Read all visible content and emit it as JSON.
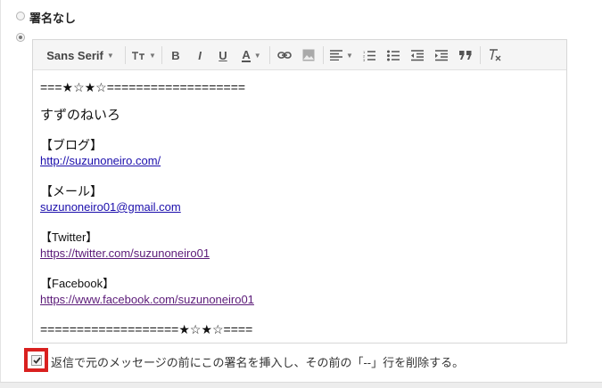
{
  "signature_options": {
    "no_signature_label": "署名なし",
    "no_signature_selected": false,
    "custom_signature_selected": true
  },
  "toolbar": {
    "font_family": "Sans Serif",
    "icons": [
      "font-size-icon",
      "bold-icon",
      "italic-icon",
      "underline-icon",
      "text-color-icon",
      "link-icon",
      "image-icon",
      "align-icon",
      "numbered-list-icon",
      "bulleted-list-icon",
      "indent-less-icon",
      "indent-more-icon",
      "quote-icon",
      "remove-formatting-icon"
    ],
    "bold": "B",
    "italic": "I",
    "underline": "U",
    "text_color": "A"
  },
  "signature": {
    "top_border": "===★☆★☆===================",
    "name": "すずのねいろ",
    "blog_heading": "【ブログ】",
    "blog_url": "http://suzunoneiro.com/",
    "mail_heading": "【メール】",
    "mail_address": "suzunoneiro01@gmail.com",
    "twitter_heading": "【Twitter】",
    "twitter_url": "https://twitter.com/suzunoneiro01",
    "facebook_heading": "【Facebook】",
    "facebook_url": "https://www.facebook.com/suzunoneiro01",
    "bottom_border": "===================★☆★☆===="
  },
  "insert_before_quote": {
    "checked": true,
    "label": "返信で元のメッセージの前にこの署名を挿入し、その前の「--」行を削除する。"
  },
  "colors": {
    "highlight": "#d9201f",
    "link": "#1a0dab",
    "visited_link": "#5b1a78"
  }
}
